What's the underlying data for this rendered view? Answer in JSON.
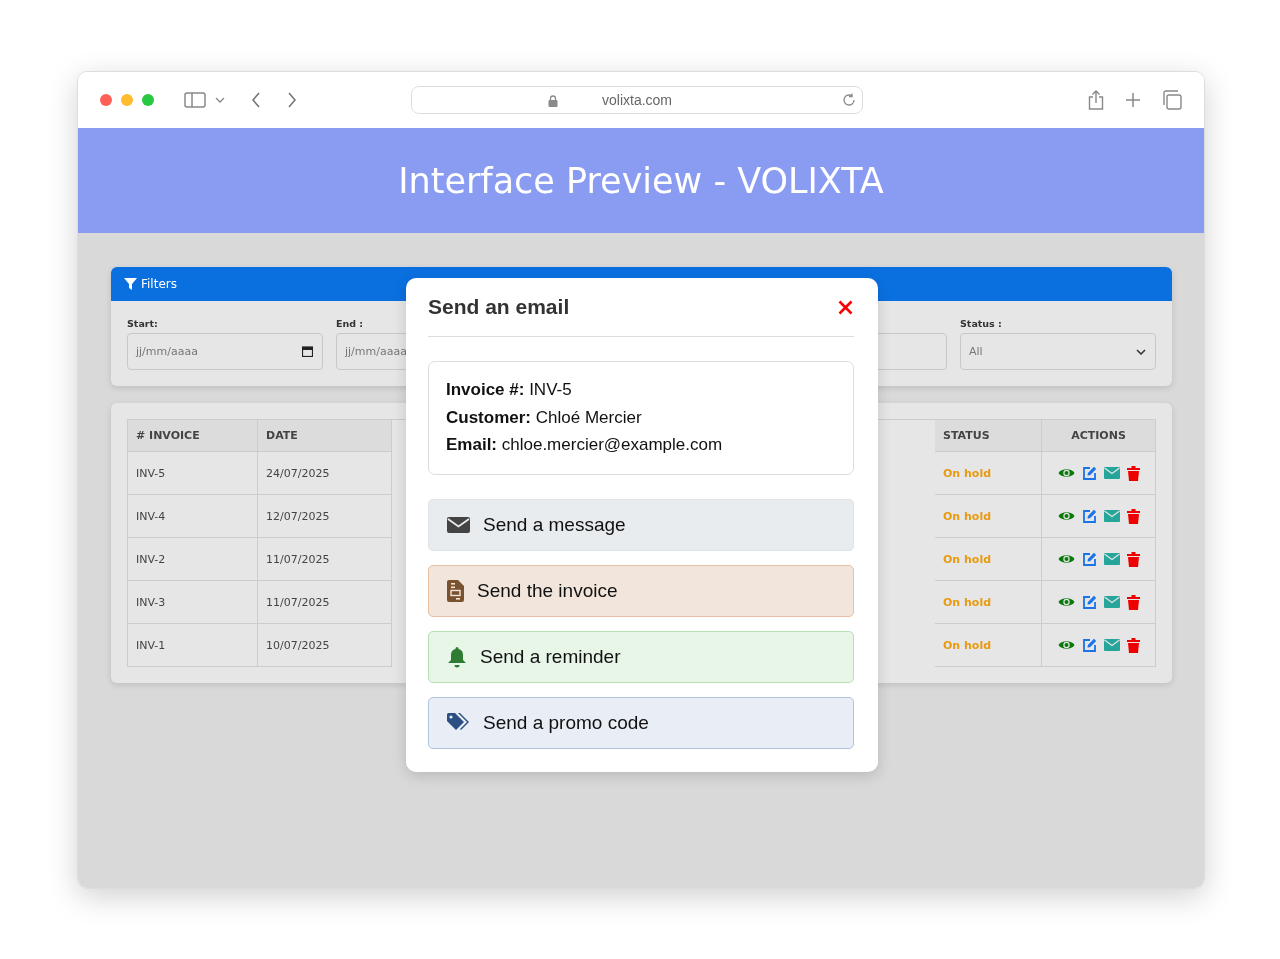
{
  "browser": {
    "url": "volixta.com"
  },
  "header": {
    "title": "Interface Preview - VOLIXTA"
  },
  "filters": {
    "title": "Filters",
    "fields": [
      {
        "kind": "date",
        "label": "Start:",
        "placeholder": "jj/mm/aaaa"
      },
      {
        "kind": "date",
        "label": "End :",
        "placeholder": "jj/mm/aaaa"
      },
      {
        "kind": "text"
      },
      {
        "kind": "select",
        "label": "Status :",
        "value": "All"
      }
    ]
  },
  "table": {
    "columns": [
      "# INVOICE",
      "DATE",
      "STATUS",
      "ACTIONS"
    ],
    "rows": [
      {
        "invoice": "INV-5",
        "date": "24/07/2025",
        "status": "On hold"
      },
      {
        "invoice": "INV-4",
        "date": "12/07/2025",
        "status": "On hold"
      },
      {
        "invoice": "INV-2",
        "date": "11/07/2025",
        "status": "On hold"
      },
      {
        "invoice": "INV-3",
        "date": "11/07/2025",
        "status": "On hold"
      },
      {
        "invoice": "INV-1",
        "date": "10/07/2025",
        "status": "On hold"
      }
    ]
  },
  "modal": {
    "title": "Send an email",
    "details": [
      "**Invoice #:** INV-5",
      "**Customer:** Chloé Mercier",
      "**Email:** chloe.mercier@example.com"
    ],
    "options": [
      {
        "kind": "message",
        "label": "Send a message"
      },
      {
        "kind": "invoice",
        "label": "Send the invoice"
      },
      {
        "kind": "reminder",
        "label": "Send a reminder"
      },
      {
        "kind": "promo",
        "label": "Send a promo code"
      }
    ]
  }
}
